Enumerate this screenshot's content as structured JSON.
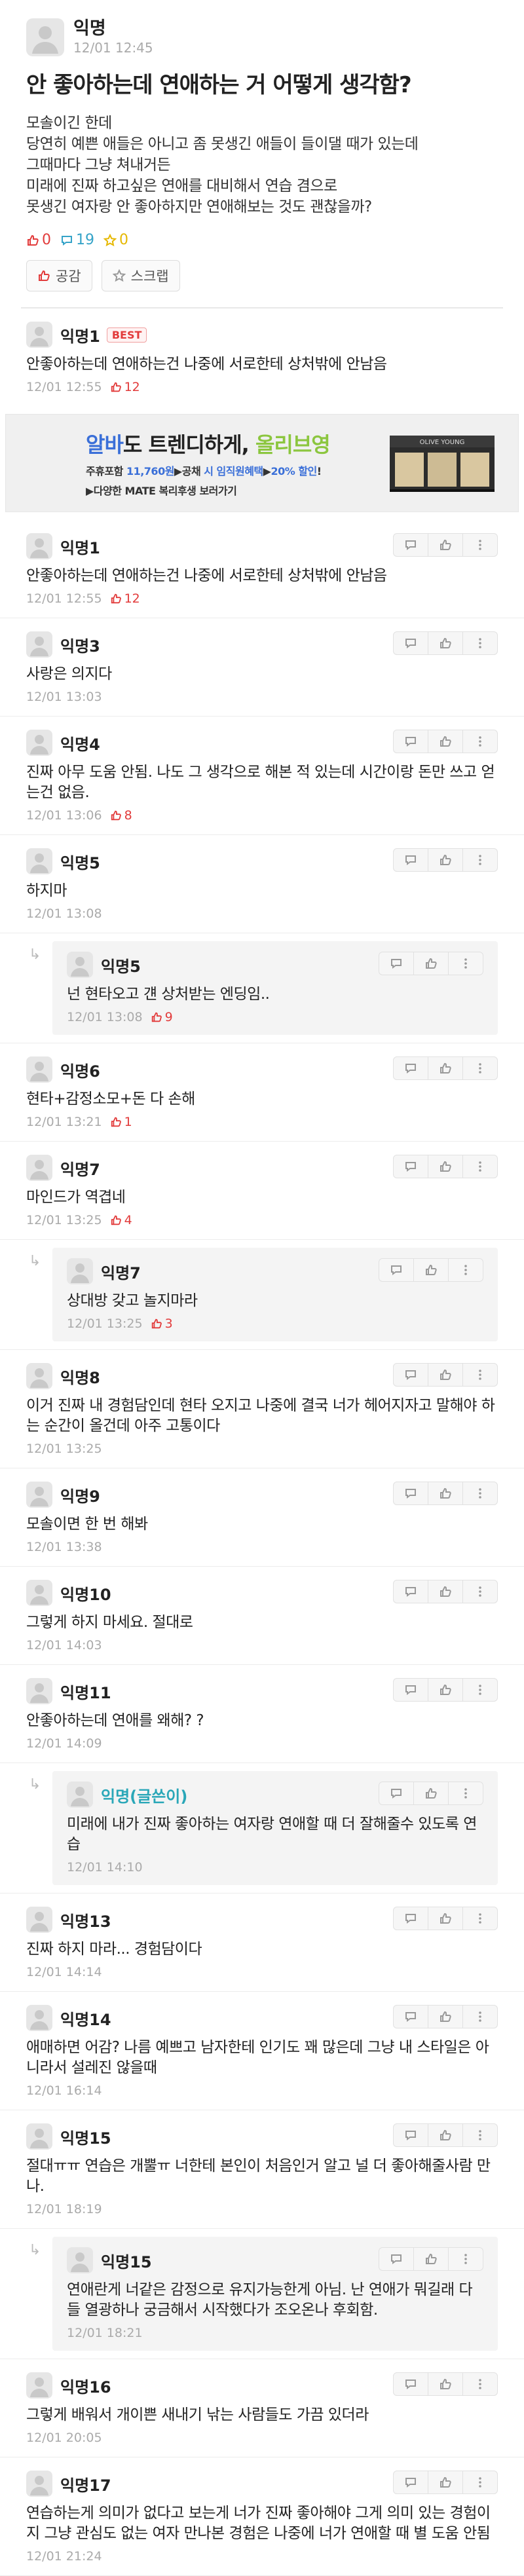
{
  "post": {
    "author": "익명",
    "time": "12/01 12:45",
    "title": "안 좋아하는데 연애하는 거 어떻게 생각함?",
    "body": "모솔이긴 한데\n당연히 예쁜 애들은 아니고 좀 못생긴 애들이 들이댈 때가 있는데\n그때마다 그냥 쳐내거든\n미래에 진짜 하고싶은 연애를 대비해서 연습 겸으로\n못생긴 여자랑 안 좋아하지만 연애해보는 것도 괜찮을까?",
    "likes": "0",
    "comments": "19",
    "scraps": "0",
    "like_button": "공감",
    "scrap_button": "스크랩"
  },
  "best_comment": {
    "name": "익명1",
    "badge": "BEST",
    "text": "안좋아하는데 연애하는건 나중에 서로한테 상처밖에 안남음",
    "time": "12/01 12:55",
    "likes": "12"
  },
  "ad": {
    "title_prefix": "알바",
    "title_mid": "도 트렌디하게, ",
    "title_brand": "올리브영",
    "line1_a": "주휴포함 ",
    "line1_b": "11,760원",
    "line1_c": "▶공채 ",
    "line1_d": "시 임직원혜택",
    "line1_e": "▶",
    "line1_f": "20% 할인",
    "line1_g": "!",
    "line2": "▶다양한 MATE 복리후생 보러가기",
    "store_sign": "OLIVE YOUNG"
  },
  "comments": [
    {
      "name": "익명1",
      "text": "안좋아하는데 연애하는건 나중에 서로한테 상처밖에 안남음",
      "time": "12/01 12:55",
      "likes": "12",
      "reply": false
    },
    {
      "name": "익명3",
      "text": "사랑은 의지다",
      "time": "12/01 13:03",
      "likes": "",
      "reply": false
    },
    {
      "name": "익명4",
      "text": "진짜 아무 도움 안됨. 나도 그 생각으로 해본 적 있는데 시간이랑 돈만 쓰고 얻는건 없음.",
      "time": "12/01 13:06",
      "likes": "8",
      "reply": false
    },
    {
      "name": "익명5",
      "text": "하지마",
      "time": "12/01 13:08",
      "likes": "",
      "reply": false
    },
    {
      "name": "익명5",
      "text": "넌 현타오고 걘 상처받는 엔딩임..",
      "time": "12/01 13:08",
      "likes": "9",
      "reply": true
    },
    {
      "name": "익명6",
      "text": "현타+감정소모+돈 다 손해",
      "time": "12/01 13:21",
      "likes": "1",
      "reply": false
    },
    {
      "name": "익명7",
      "text": "마인드가 역겹네",
      "time": "12/01 13:25",
      "likes": "4",
      "reply": false
    },
    {
      "name": "익명7",
      "text": "상대방 갖고 놀지마라",
      "time": "12/01 13:25",
      "likes": "3",
      "reply": true
    },
    {
      "name": "익명8",
      "text": "이거 진짜 내 경험담인데 현타 오지고 나중에 결국 너가 헤어지자고 말해야 하는 순간이 올건데 아주 고통이다",
      "time": "12/01 13:25",
      "likes": "",
      "reply": false
    },
    {
      "name": "익명9",
      "text": "모솔이면 한 번 해봐",
      "time": "12/01 13:38",
      "likes": "",
      "reply": false
    },
    {
      "name": "익명10",
      "text": "그렇게 하지 마세요. 절대로",
      "time": "12/01 14:03",
      "likes": "",
      "reply": false
    },
    {
      "name": "익명11",
      "text": "안좋아하는데 연애를 왜해? ?",
      "time": "12/01 14:09",
      "likes": "",
      "reply": false
    },
    {
      "name": "익명(글쓴이)",
      "text": "미래에 내가 진짜 좋아하는 여자랑 연애할 때 더 잘해줄수 있도록 연습",
      "time": "12/01 14:10",
      "likes": "",
      "reply": true,
      "op": true
    },
    {
      "name": "익명13",
      "text": "진짜 하지 마라... 경험담이다",
      "time": "12/01 14:14",
      "likes": "",
      "reply": false
    },
    {
      "name": "익명14",
      "text": "애매하면 어감? 나름 예쁘고 남자한테 인기도 꽤 많은데 그냥 내 스타일은 아니라서 설레진 않을때",
      "time": "12/01 16:14",
      "likes": "",
      "reply": false
    },
    {
      "name": "익명15",
      "text": "절대ㅠㅠ 연습은 개뿔ㅠ 너한테 본인이 처음인거 알고 널 더 좋아해줄사람 만나.",
      "time": "12/01 18:19",
      "likes": "",
      "reply": false
    },
    {
      "name": "익명15",
      "text": "연애란게 너같은 감정으로 유지가능한게 아님. 난 연애가 뭐길래 다들 열광하나 궁금해서 시작했다가 조오온나 후회함.",
      "time": "12/01 18:21",
      "likes": "",
      "reply": true
    },
    {
      "name": "익명16",
      "text": "그렇게 배워서 개이쁜 새내기 낚는 사람들도 가끔 있더라",
      "time": "12/01 20:05",
      "likes": "",
      "reply": false
    },
    {
      "name": "익명17",
      "text": "연습하는게 의미가 없다고 보는게 너가 진짜 좋아해야 그게 의미 있는 경험이지 그냥 관심도 없는 여자 만나본 경험은 나중에 너가 연애할 때 별 도움 안됨",
      "time": "12/01 21:24",
      "likes": "",
      "reply": false
    }
  ],
  "colors": {
    "like": "#e23b3b",
    "comment": "#35a3c8",
    "scrap": "#e6b800",
    "op_name": "#2aa7b8"
  }
}
